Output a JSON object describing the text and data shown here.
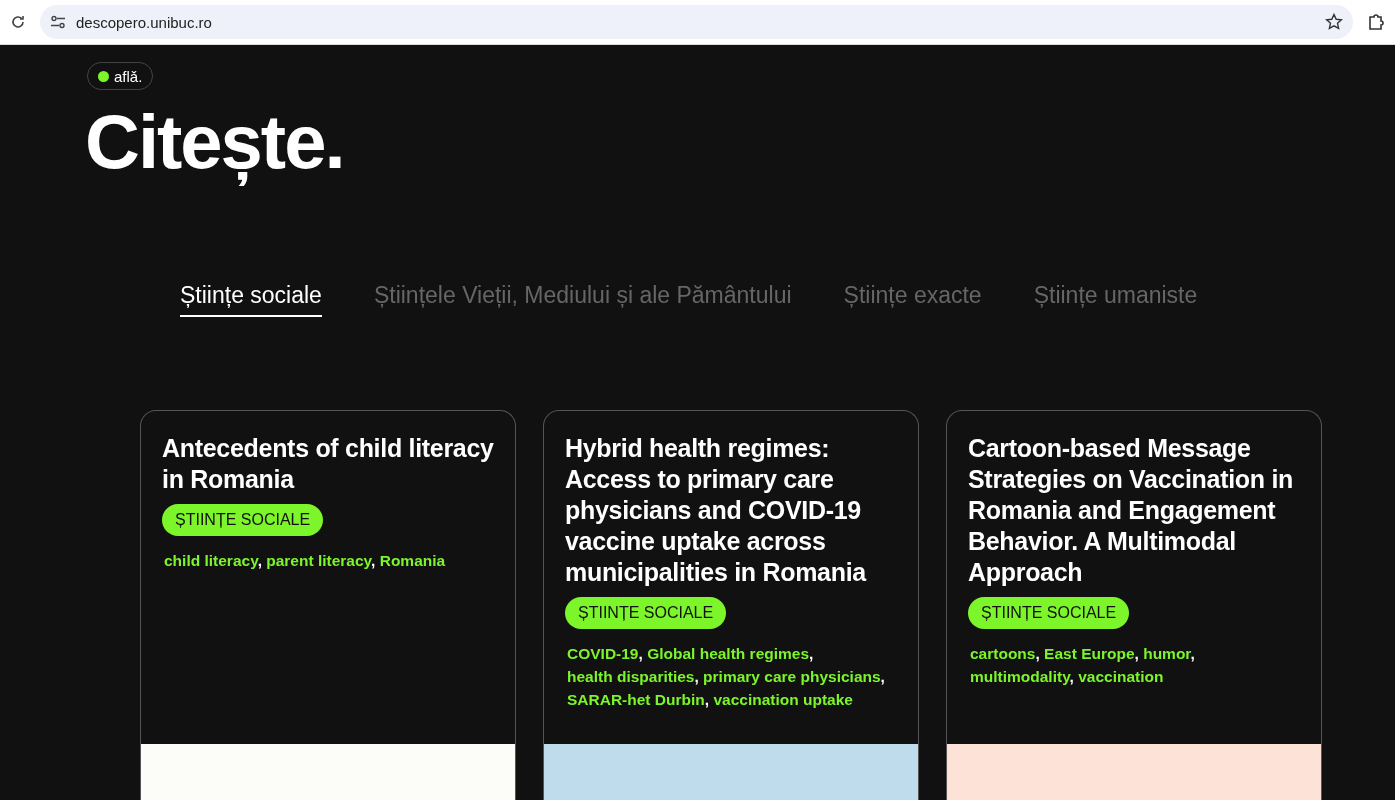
{
  "browser": {
    "url": "descopero.unibuc.ro"
  },
  "badge": {
    "label": "aflǎ.",
    "color": "#7cf52a"
  },
  "heading": "Citește.",
  "tabs": [
    {
      "label": "Științe sociale",
      "selected": true
    },
    {
      "label": "Științele Vieții, Mediului și ale Pământului",
      "selected": false
    },
    {
      "label": "Științe exacte",
      "selected": false
    },
    {
      "label": "Științe umaniste",
      "selected": false
    }
  ],
  "cards": [
    {
      "title": "Antecedents of child literacy in Romania",
      "tag": "ȘTIINȚE SOCIALE",
      "keywords": [
        {
          "label": "child literacy",
          "separator": ","
        },
        {
          "label": "parent literacy",
          "separator": ","
        },
        {
          "label": "Romania"
        }
      ],
      "color": "#fcfcf8"
    },
    {
      "title": "Hybrid health regimes: Access to primary care physicians and COVID-19 vaccine uptake across municipalities in Romania",
      "tag": "ȘTIINȚE SOCIALE",
      "keywords": [
        {
          "label": "COVID-19",
          "separator": ","
        },
        {
          "label": "Global health regimes",
          "separator": ","
        },
        {
          "label": "health disparities",
          "separator": ","
        },
        {
          "label": "primary care physicians",
          "separator": ","
        },
        {
          "label": "SARAR-het Durbin",
          "separator": ","
        },
        {
          "label": "vaccination uptake"
        }
      ],
      "color": "#bfdcec"
    },
    {
      "title": "Cartoon-based Message Strategies on Vaccination in Romania and Engagement Behavior. A Multimodal Approach",
      "tag": "ȘTIINȚE SOCIALE",
      "keywords": [
        {
          "label": "cartoons",
          "separator": ","
        },
        {
          "label": "East Europe",
          "separator": ","
        },
        {
          "label": "humor",
          "separator": ","
        },
        {
          "label": "multimodality",
          "separator": ","
        },
        {
          "label": "vaccination"
        }
      ],
      "color": "#fde2d8"
    }
  ]
}
